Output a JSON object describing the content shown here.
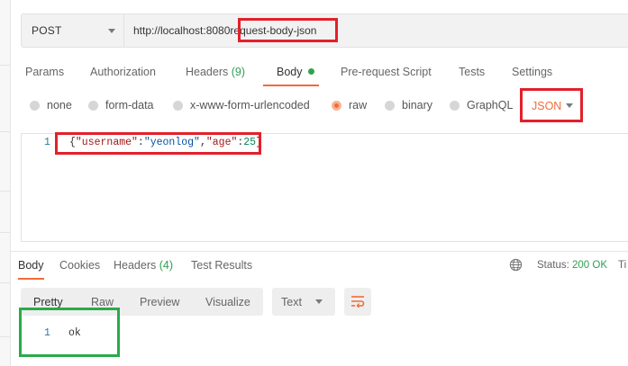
{
  "request": {
    "method": "POST",
    "url_base": "http://localhost:8080",
    "url_path": "request-body-json"
  },
  "request_tabs": [
    {
      "label": "Params"
    },
    {
      "label": "Authorization"
    },
    {
      "label": "Headers",
      "count": "(9)"
    },
    {
      "label": "Body"
    },
    {
      "label": "Pre-request Script"
    },
    {
      "label": "Tests"
    },
    {
      "label": "Settings"
    }
  ],
  "body_types": [
    "none",
    "form-data",
    "x-www-form-urlencoded",
    "raw",
    "binary",
    "GraphQL"
  ],
  "body_type_selected": "raw",
  "raw_format": "JSON",
  "editor": {
    "line_number": "1",
    "code_open": "{",
    "key_username": "\"username\"",
    "colon1": ":",
    "value_username": "\"yeonlog\"",
    "comma": ",",
    "key_age": "\"age\"",
    "colon2": ":",
    "value_age": "25",
    "code_close": "}"
  },
  "response_tabs": [
    {
      "label": "Body"
    },
    {
      "label": "Cookies"
    },
    {
      "label": "Headers",
      "count": "(4)"
    },
    {
      "label": "Test Results"
    }
  ],
  "status": {
    "label": "Status:",
    "value": "200 OK",
    "time_label": "Ti"
  },
  "view_modes": [
    "Pretty",
    "Raw",
    "Preview",
    "Visualize"
  ],
  "response_format": "Text",
  "response_body": {
    "line_number": "1",
    "text": "ok"
  },
  "colors": {
    "accent": "#f26b3a",
    "status_ok": "#2f9e52",
    "annotation_red": "#e3202a",
    "annotation_green": "#2aaa4a"
  }
}
